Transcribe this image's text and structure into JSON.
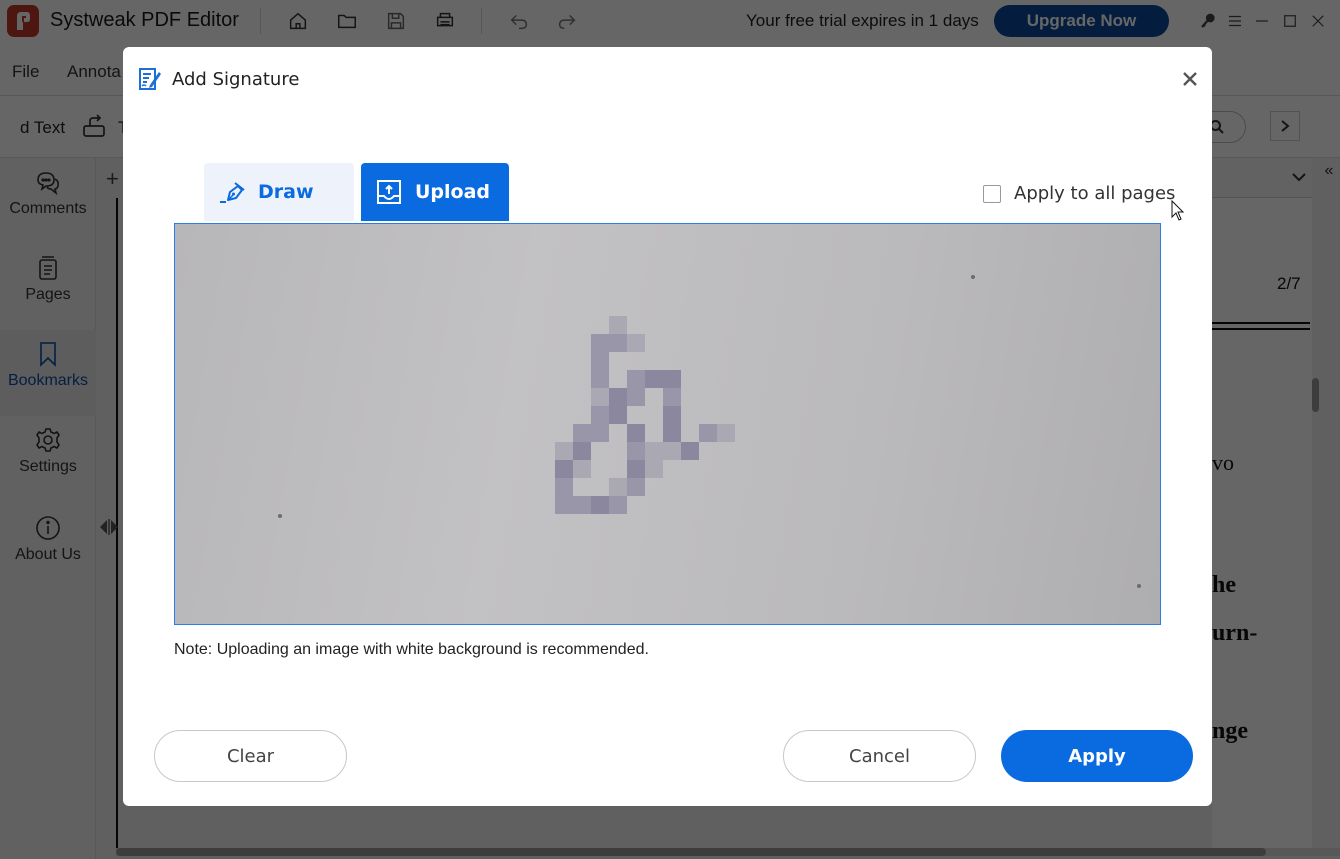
{
  "app": {
    "title": "Systweak PDF Editor",
    "trial_text": "Your free trial expires in 1 days",
    "upgrade_label": "Upgrade Now",
    "brand_color": "#0a4a9e"
  },
  "toolbar_icons": [
    "home-icon",
    "folder-icon",
    "save-icon",
    "print-icon",
    "undo-icon",
    "redo-icon"
  ],
  "window_controls": [
    "key-icon",
    "menu-icon",
    "minimize-icon",
    "maximize-icon",
    "close-icon"
  ],
  "menu": {
    "items": [
      {
        "label": "File"
      },
      {
        "label": "Annota"
      }
    ]
  },
  "toolbar": {
    "text_tool_label": "d Text",
    "partial_label": "T"
  },
  "sidebar": {
    "items": [
      {
        "label": "Comments",
        "icon": "comments-icon",
        "active": false
      },
      {
        "label": "Pages",
        "icon": "pages-icon",
        "active": false
      },
      {
        "label": "Bookmarks",
        "icon": "bookmark-icon",
        "active": true
      },
      {
        "label": "Settings",
        "icon": "gear-icon",
        "active": false
      },
      {
        "label": "About Us",
        "icon": "info-icon",
        "active": false
      }
    ],
    "active_color": "#0b4fa8"
  },
  "document": {
    "add_tab": "+",
    "page_counter": "2/7",
    "visible_fragments": [
      "vo",
      "he",
      "urn-",
      "nge"
    ]
  },
  "dialog": {
    "title": "Add Signature",
    "tabs": [
      {
        "label": "Draw",
        "active": false
      },
      {
        "label": "Upload",
        "active": true
      }
    ],
    "apply_all_label": "Apply to all pages",
    "apply_all_checked": false,
    "note": "Note: Uploading an image with white background is recommended.",
    "buttons": {
      "clear": "Clear",
      "cancel": "Cancel",
      "apply": "Apply"
    },
    "accent_color": "#0a6be0"
  }
}
